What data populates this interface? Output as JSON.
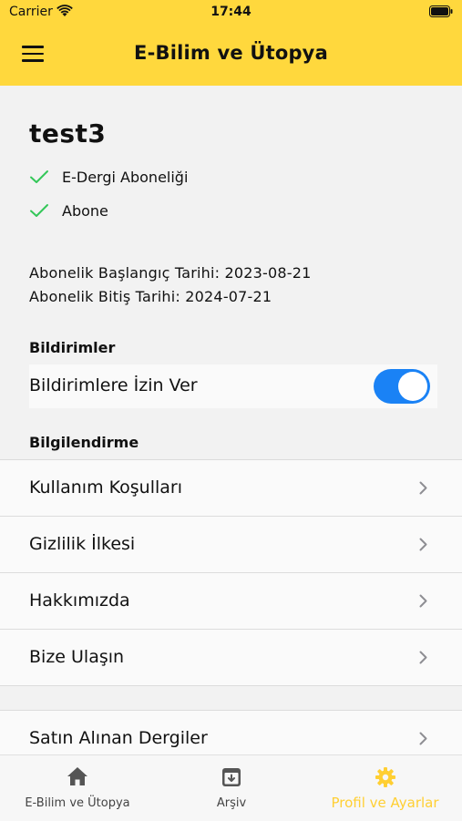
{
  "status": {
    "carrier": "Carrier",
    "time": "17:44"
  },
  "nav": {
    "title": "E-Bilim ve Ütopya"
  },
  "profile": {
    "username": "test3",
    "badges": [
      "E-Dergi Aboneliği",
      "Abone"
    ],
    "start_date": "Abonelik Başlangıç Tarihi: 2023-08-21",
    "end_date": "Abonelik Bitiş Tarihi: 2024-07-21"
  },
  "notifications": {
    "header": "Bildirimler",
    "toggle_label": "Bildirimlere İzin Ver",
    "enabled": true
  },
  "info": {
    "header": "Bilgilendirme",
    "items": [
      "Kullanım Koşulları",
      "Gizlilik İlkesi",
      "Hakkımızda",
      "Bize Ulaşın"
    ]
  },
  "purchases": {
    "label": "Satın Alınan Dergiler"
  },
  "tabs": [
    {
      "label": "E-Bilim ve Ütopya",
      "icon": "home-icon",
      "active": false
    },
    {
      "label": "Arşiv",
      "icon": "archive-icon",
      "active": false
    },
    {
      "label": "Profil ve Ayarlar",
      "icon": "gear-icon",
      "active": true
    }
  ],
  "colors": {
    "header": "#ffd83d",
    "accent": "#ffcf33",
    "toggle_on": "#1a82f5",
    "check": "#34c759"
  }
}
